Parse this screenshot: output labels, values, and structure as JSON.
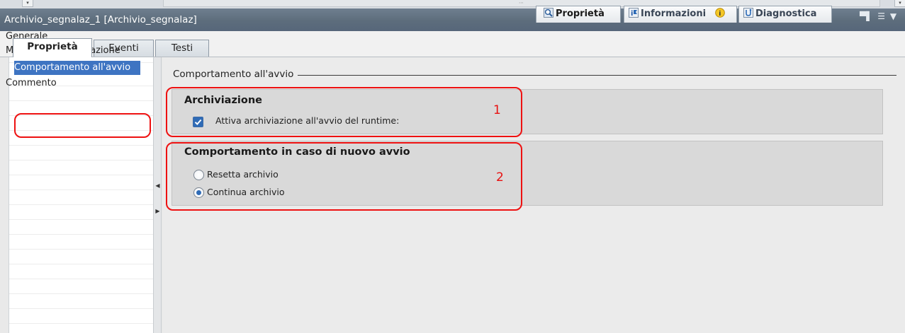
{
  "window_title": "Archivio_segnalaz_1 [Archivio_segnalaz]",
  "inspector_tabs": [
    {
      "label": "Proprietà",
      "icon": "magnifier-icon",
      "active": true
    },
    {
      "label": "Informazioni",
      "icon": "info-flag-icon",
      "active": false
    },
    {
      "label": "Diagnostica",
      "icon": "diagnostics-icon",
      "active": false
    }
  ],
  "editor_tabs": [
    {
      "label": "Proprietà",
      "active": true
    },
    {
      "label": "Eventi",
      "active": false
    },
    {
      "label": "Testi",
      "active": false
    }
  ],
  "left_nav": {
    "items": [
      {
        "label": "Generale"
      },
      {
        "label": "Modalità di archiviazione"
      },
      {
        "label": "Comportamento all'avvio",
        "selected": true
      },
      {
        "label": "Commento"
      }
    ]
  },
  "section": {
    "heading": "Comportamento all'avvio"
  },
  "group1": {
    "title": "Archiviazione",
    "checkbox_label": "Attiva archiviazione all'avvio del runtime:",
    "checked": true
  },
  "group2": {
    "title": "Comportamento in caso di nuovo avvio",
    "options": [
      {
        "label": "Resetta archivio",
        "selected": false
      },
      {
        "label": "Continua archivio",
        "selected": true
      }
    ]
  },
  "annotations": {
    "num1": "1",
    "num2": "2"
  },
  "colors": {
    "selection": "#3e74c2",
    "annotation": "#ee1111",
    "title_bar": "#5d6d7c"
  }
}
